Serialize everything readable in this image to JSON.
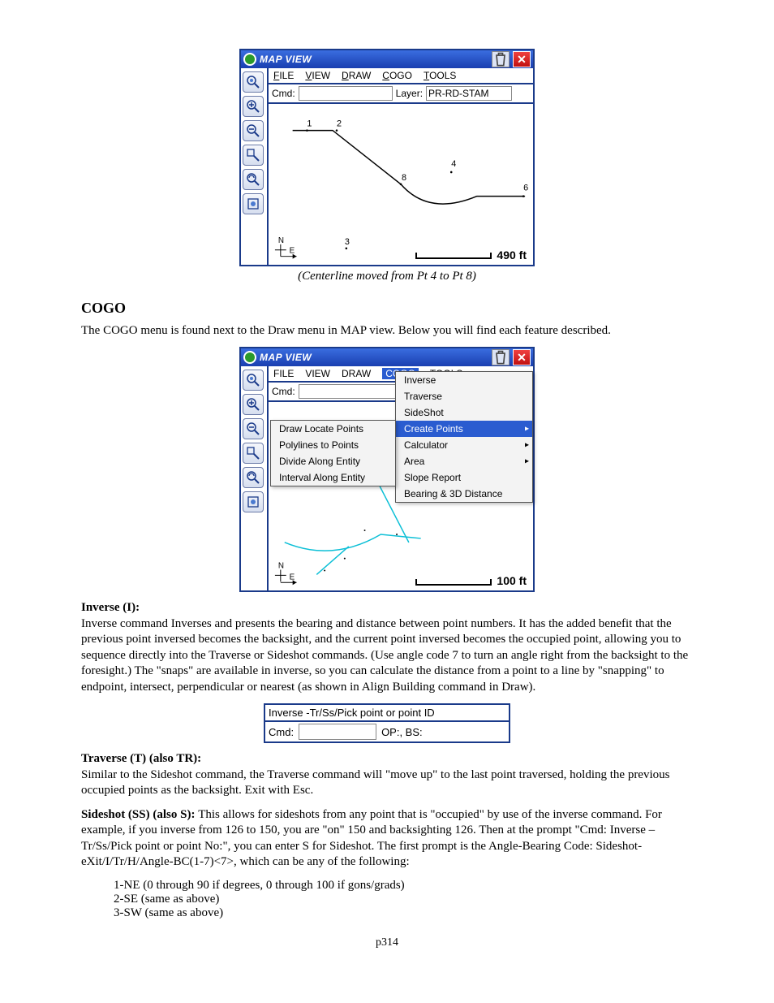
{
  "mapview1": {
    "title": "MAP VIEW",
    "menu": [
      "FILE",
      "VIEW",
      "DRAW",
      "COGO",
      "TOOLS"
    ],
    "cmd_label": "Cmd:",
    "cmd_value": "",
    "layer_label": "Layer:",
    "layer_value": "PR-RD-STAM",
    "canvas_points": {
      "p1": "1",
      "p2": "2",
      "p3": "3",
      "p4": "4",
      "p6": "6",
      "p8": "8"
    },
    "scale": "490 ft"
  },
  "caption1": "(Centerline moved from Pt 4 to Pt 8)",
  "heading_cogo": "COGO",
  "cogo_intro": "The COGO menu is found next to the Draw menu in MAP view. Below you will find each feature described.",
  "mapview2": {
    "title": "MAP VIEW",
    "menu": [
      "FILE",
      "VIEW",
      "DRAW",
      "COGO",
      "TOOLS"
    ],
    "cmd_label": "Cmd:",
    "cmd_value": "",
    "cogo_menu_left": [
      "Draw Locate Points",
      "Polylines to Points",
      "Divide Along Entity",
      "Interval Along Entity"
    ],
    "cogo_menu_right": [
      "Inverse",
      "Traverse",
      "SideShot",
      "Create Points",
      "Calculator",
      "Area",
      "Slope Report",
      "Bearing & 3D Distance"
    ],
    "cogo_highlight": "Create Points",
    "scale": "100 ft"
  },
  "inverse_head": "Inverse (I):",
  "inverse_body": "Inverse command Inverses and presents the bearing and distance between point numbers.  It has the added benefit that the previous point inversed becomes the backsight, and the current point inversed becomes the occupied point, allowing you to sequence directly into the Traverse or Sideshot commands.  (Use angle code 7 to turn an angle right from the backsight to the foresight.)  The \"snaps\" are available in inverse, so you can calculate the distance from a point to a line by \"snapping\" to endpoint, intersect, perpendicular or nearest (as shown in Align Building command in Draw).",
  "promptbox": {
    "line1": "Inverse -Tr/Ss/Pick point or point ID",
    "cmd_label": "Cmd:",
    "cmd_value": "",
    "status": "OP:, BS:"
  },
  "traverse_head": "Traverse (T) (also TR):",
  "traverse_body": "Similar to the Sideshot command, the Traverse command will \"move up\" to the last point traversed, holding the previous occupied points as the backsight.  Exit with Esc.",
  "sideshot_head": "Sideshot (SS) (also S): ",
  "sideshot_body": "This allows for sideshots from any point that is \"occupied\" by use of the inverse command. For example, if you inverse from 126 to 150, you are \"on\" 150 and backsighting 126.  Then at the prompt \"Cmd: Inverse – Tr/Ss/Pick point or point No:\", you can enter S for Sideshot.  The first prompt is the Angle-Bearing Code: Sideshot-eXit/I/Tr/H/Angle-BC(1-7)<7>, which can be any of the following:",
  "codes": [
    "1-NE (0 through 90 if degrees, 0 through 100 if gons/grads)",
    "2-SE (same as above)",
    "3-SW (same as above)"
  ],
  "page_number": "p314"
}
